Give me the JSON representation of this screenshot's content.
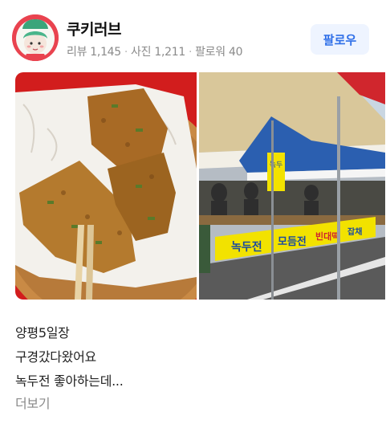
{
  "profile": {
    "username": "쿠키러브",
    "reviews": "리뷰 1,145",
    "photos": "사진 1,211",
    "followers": "팔로워 40",
    "separator": "·",
    "follow_label": "팔로우",
    "follow_color": "#2f6fe8"
  },
  "images": {
    "first_icon": "food-photo",
    "second_icon": "market-photo",
    "banner_text_1": "녹두전",
    "banner_text_2": "모듬전",
    "banner_text_3": "빈대떡",
    "banner_text_4": "잡채",
    "sign_text": "녹두"
  },
  "post": {
    "lines": [
      "양평5일장",
      "구경갔다왔어요",
      "녹두전 좋아하는데..."
    ],
    "more_label": "더보기"
  }
}
